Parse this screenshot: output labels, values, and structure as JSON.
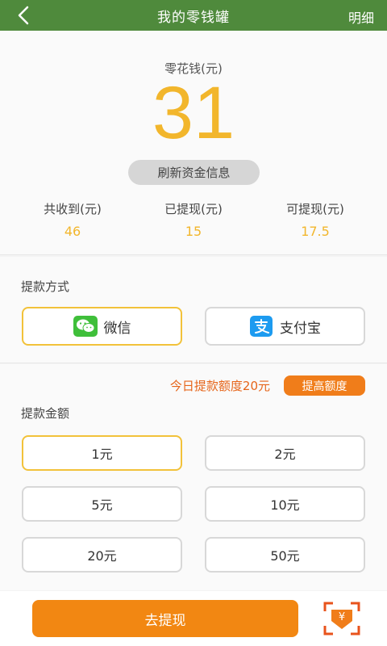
{
  "header": {
    "title": "我的零钱罐",
    "detail_label": "明细"
  },
  "balance": {
    "label": "零花钱(元)",
    "value": "31",
    "refresh_label": "刷新资金信息"
  },
  "stats": [
    {
      "label": "共收到(元)",
      "value": "46"
    },
    {
      "label": "已提现(元)",
      "value": "15"
    },
    {
      "label": "可提现(元)",
      "value": "17.5"
    }
  ],
  "method": {
    "label": "提款方式",
    "options": [
      {
        "label": "微信",
        "icon": "wechat-icon",
        "selected": true
      },
      {
        "label": "支付宝",
        "icon": "alipay-icon",
        "selected": false
      }
    ]
  },
  "amount": {
    "limit_text": "今日提款额度20元",
    "raise_limit_label": "提高额度",
    "label": "提款金额",
    "options": [
      {
        "label": "1元",
        "selected": true
      },
      {
        "label": "2元",
        "selected": false
      },
      {
        "label": "5元",
        "selected": false
      },
      {
        "label": "10元",
        "selected": false
      },
      {
        "label": "20元",
        "selected": false
      },
      {
        "label": "50元",
        "selected": false
      }
    ]
  },
  "footer": {
    "withdraw_label": "去提现",
    "scan_icon_text": "¥"
  },
  "colors": {
    "header_green": "#4f8a3c",
    "accent_yellow": "#f2b62c",
    "selected_border": "#f2c23a",
    "orange": "#f28712",
    "limit_orange": "#e6651a"
  }
}
